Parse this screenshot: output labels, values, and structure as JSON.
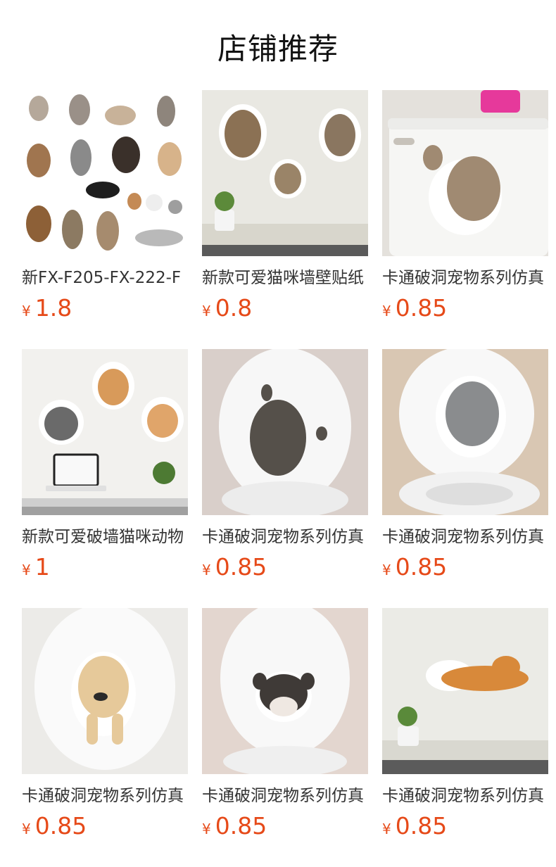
{
  "section": {
    "title": "店铺推荐"
  },
  "products": [
    {
      "title": "新FX-F205-FX-222-F",
      "currency": "¥",
      "price": "1.8",
      "image": "pet-stickers-sheet"
    },
    {
      "title": "新款可爱猫咪墙壁贴纸",
      "currency": "¥",
      "price": "0.8",
      "image": "cats-wall-sticker"
    },
    {
      "title": "卡通破洞宠物系列仿真",
      "currency": "¥",
      "price": "0.85",
      "image": "cat-toilet-sticker"
    },
    {
      "title": "新款可爱破墙猫咪动物",
      "currency": "¥",
      "price": "1",
      "image": "cats-desk-wall-sticker"
    },
    {
      "title": "卡通破洞宠物系列仿真",
      "currency": "¥",
      "price": "0.85",
      "image": "grey-cat-toilet-lid"
    },
    {
      "title": "卡通破洞宠物系列仿真",
      "currency": "¥",
      "price": "0.85",
      "image": "blue-cat-toilet-lid"
    },
    {
      "title": "卡通破洞宠物系列仿真",
      "currency": "¥",
      "price": "0.85",
      "image": "golden-retriever-toilet-lid"
    },
    {
      "title": "卡通破洞宠物系列仿真",
      "currency": "¥",
      "price": "0.85",
      "image": "bulldog-toilet-lid"
    },
    {
      "title": "卡通破洞宠物系列仿真",
      "currency": "¥",
      "price": "0.85",
      "image": "orange-cat-wall-sticker"
    }
  ],
  "colors": {
    "price": "#e64a19",
    "title": "#333333"
  }
}
